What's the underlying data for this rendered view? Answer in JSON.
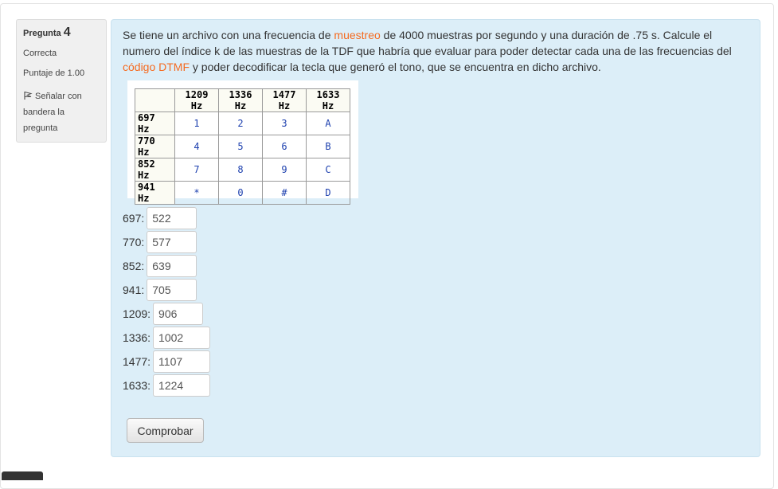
{
  "info": {
    "question_label": "Pregunta",
    "question_number": "4",
    "state": "Correcta",
    "grade": "Puntaje de 1.00",
    "flag_label": "Señalar con bandera la pregunta"
  },
  "question": {
    "text_1": "Se tiene un archivo con una frecuencia de ",
    "link_1": "muestreo",
    "text_2": " de 4000 muestras por segundo y una duración de .75 s. Calcule el numero del índice k de las muestras de la TDF que habría que evaluar para poder detectar cada una de las frecuencias del ",
    "link_2": "código DTMF",
    "text_3": " y poder decodificar la tecla que generó el tono, que se encuentra en dicho archivo."
  },
  "dtmf_table": {
    "col_headers": [
      "1209 Hz",
      "1336 Hz",
      "1477 Hz",
      "1633 Hz"
    ],
    "rows": [
      {
        "label": "697 Hz",
        "keys": [
          "1",
          "2",
          "3",
          "A"
        ]
      },
      {
        "label": "770 Hz",
        "keys": [
          "4",
          "5",
          "6",
          "B"
        ]
      },
      {
        "label": "852 Hz",
        "keys": [
          "7",
          "8",
          "9",
          "C"
        ]
      },
      {
        "label": "941 Hz",
        "keys": [
          "*",
          "0",
          "#",
          "D"
        ]
      }
    ]
  },
  "answers": [
    {
      "label": "697:",
      "value": "522"
    },
    {
      "label": "770:",
      "value": "577"
    },
    {
      "label": "852:",
      "value": "639"
    },
    {
      "label": "941:",
      "value": "705"
    },
    {
      "label": "1209:",
      "value": "906"
    },
    {
      "label": "1336:",
      "value": "1002"
    },
    {
      "label": "1477:",
      "value": "1107"
    },
    {
      "label": "1633:",
      "value": "1224"
    }
  ],
  "check_button": "Comprobar",
  "colors": {
    "content_bg": "#dceef8",
    "link": "#f56a1f",
    "key_text": "#1c3fae"
  },
  "icons": {
    "flag": "flag-icon"
  }
}
